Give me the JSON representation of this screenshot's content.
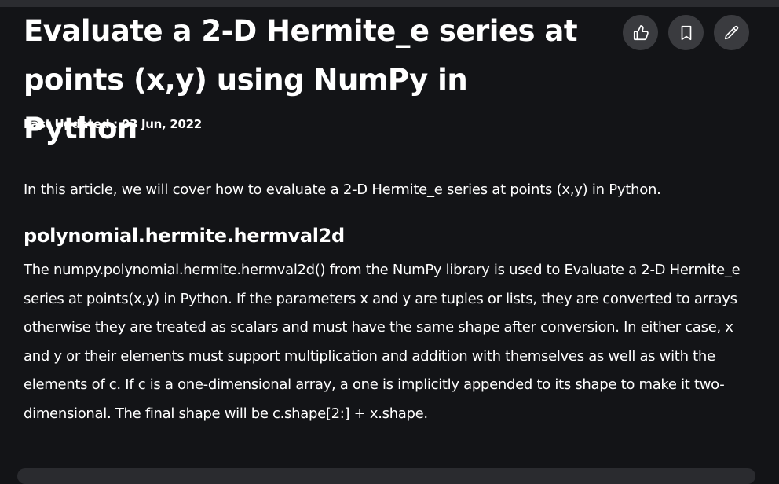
{
  "article": {
    "title": "Evaluate a 2-D Hermite_e series at points (x,y) using NumPy in Python",
    "last_updated": "Last Updated : 03 Jun, 2022",
    "intro": "In this article, we will cover how to evaluate a 2-D Hermite_e series at points (x,y) in Python.",
    "section_heading": "polynomial.hermite.hermval2d",
    "description": "The numpy.polynomial.hermite.hermval2d() from the NumPy library is used to Evaluate a 2-D Hermite_e series at points(x,y) in Python. If the parameters x and y are tuples or lists, they are converted to arrays otherwise they are treated as scalars and must have the same shape after conversion. In either case, x and y or their elements must support multiplication and addition with themselves as well as with the elements of c. If c is a one-dimensional array, a one is implicitly appended to its shape to make it two-dimensional. The final shape will be c.shape[2:] + x.shape."
  },
  "actions": [
    {
      "icon": "thumbs-up-icon"
    },
    {
      "icon": "bookmark-icon"
    },
    {
      "icon": "pencil-icon"
    }
  ],
  "colors": {
    "background": "#131417",
    "text": "#ffffff",
    "button_bg": "#3a3b3f"
  }
}
